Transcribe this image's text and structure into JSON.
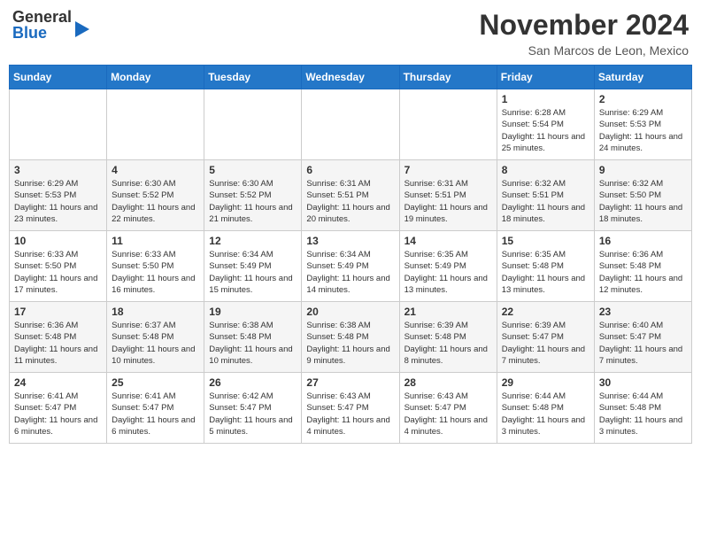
{
  "header": {
    "logo_general": "General",
    "logo_blue": "Blue",
    "month_title": "November 2024",
    "subtitle": "San Marcos de Leon, Mexico"
  },
  "days_of_week": [
    "Sunday",
    "Monday",
    "Tuesday",
    "Wednesday",
    "Thursday",
    "Friday",
    "Saturday"
  ],
  "weeks": [
    {
      "days": [
        {
          "date": "",
          "info": ""
        },
        {
          "date": "",
          "info": ""
        },
        {
          "date": "",
          "info": ""
        },
        {
          "date": "",
          "info": ""
        },
        {
          "date": "",
          "info": ""
        },
        {
          "date": "1",
          "info": "Sunrise: 6:28 AM\nSunset: 5:54 PM\nDaylight: 11 hours\nand 25 minutes."
        },
        {
          "date": "2",
          "info": "Sunrise: 6:29 AM\nSunset: 5:53 PM\nDaylight: 11 hours\nand 24 minutes."
        }
      ]
    },
    {
      "days": [
        {
          "date": "3",
          "info": "Sunrise: 6:29 AM\nSunset: 5:53 PM\nDaylight: 11 hours\nand 23 minutes."
        },
        {
          "date": "4",
          "info": "Sunrise: 6:30 AM\nSunset: 5:52 PM\nDaylight: 11 hours\nand 22 minutes."
        },
        {
          "date": "5",
          "info": "Sunrise: 6:30 AM\nSunset: 5:52 PM\nDaylight: 11 hours\nand 21 minutes."
        },
        {
          "date": "6",
          "info": "Sunrise: 6:31 AM\nSunset: 5:51 PM\nDaylight: 11 hours\nand 20 minutes."
        },
        {
          "date": "7",
          "info": "Sunrise: 6:31 AM\nSunset: 5:51 PM\nDaylight: 11 hours\nand 19 minutes."
        },
        {
          "date": "8",
          "info": "Sunrise: 6:32 AM\nSunset: 5:51 PM\nDaylight: 11 hours\nand 18 minutes."
        },
        {
          "date": "9",
          "info": "Sunrise: 6:32 AM\nSunset: 5:50 PM\nDaylight: 11 hours\nand 18 minutes."
        }
      ]
    },
    {
      "days": [
        {
          "date": "10",
          "info": "Sunrise: 6:33 AM\nSunset: 5:50 PM\nDaylight: 11 hours\nand 17 minutes."
        },
        {
          "date": "11",
          "info": "Sunrise: 6:33 AM\nSunset: 5:50 PM\nDaylight: 11 hours\nand 16 minutes."
        },
        {
          "date": "12",
          "info": "Sunrise: 6:34 AM\nSunset: 5:49 PM\nDaylight: 11 hours\nand 15 minutes."
        },
        {
          "date": "13",
          "info": "Sunrise: 6:34 AM\nSunset: 5:49 PM\nDaylight: 11 hours\nand 14 minutes."
        },
        {
          "date": "14",
          "info": "Sunrise: 6:35 AM\nSunset: 5:49 PM\nDaylight: 11 hours\nand 13 minutes."
        },
        {
          "date": "15",
          "info": "Sunrise: 6:35 AM\nSunset: 5:48 PM\nDaylight: 11 hours\nand 13 minutes."
        },
        {
          "date": "16",
          "info": "Sunrise: 6:36 AM\nSunset: 5:48 PM\nDaylight: 11 hours\nand 12 minutes."
        }
      ]
    },
    {
      "days": [
        {
          "date": "17",
          "info": "Sunrise: 6:36 AM\nSunset: 5:48 PM\nDaylight: 11 hours\nand 11 minutes."
        },
        {
          "date": "18",
          "info": "Sunrise: 6:37 AM\nSunset: 5:48 PM\nDaylight: 11 hours\nand 10 minutes."
        },
        {
          "date": "19",
          "info": "Sunrise: 6:38 AM\nSunset: 5:48 PM\nDaylight: 11 hours\nand 10 minutes."
        },
        {
          "date": "20",
          "info": "Sunrise: 6:38 AM\nSunset: 5:48 PM\nDaylight: 11 hours\nand 9 minutes."
        },
        {
          "date": "21",
          "info": "Sunrise: 6:39 AM\nSunset: 5:48 PM\nDaylight: 11 hours\nand 8 minutes."
        },
        {
          "date": "22",
          "info": "Sunrise: 6:39 AM\nSunset: 5:47 PM\nDaylight: 11 hours\nand 7 minutes."
        },
        {
          "date": "23",
          "info": "Sunrise: 6:40 AM\nSunset: 5:47 PM\nDaylight: 11 hours\nand 7 minutes."
        }
      ]
    },
    {
      "days": [
        {
          "date": "24",
          "info": "Sunrise: 6:41 AM\nSunset: 5:47 PM\nDaylight: 11 hours\nand 6 minutes."
        },
        {
          "date": "25",
          "info": "Sunrise: 6:41 AM\nSunset: 5:47 PM\nDaylight: 11 hours\nand 6 minutes."
        },
        {
          "date": "26",
          "info": "Sunrise: 6:42 AM\nSunset: 5:47 PM\nDaylight: 11 hours\nand 5 minutes."
        },
        {
          "date": "27",
          "info": "Sunrise: 6:43 AM\nSunset: 5:47 PM\nDaylight: 11 hours\nand 4 minutes."
        },
        {
          "date": "28",
          "info": "Sunrise: 6:43 AM\nSunset: 5:47 PM\nDaylight: 11 hours\nand 4 minutes."
        },
        {
          "date": "29",
          "info": "Sunrise: 6:44 AM\nSunset: 5:48 PM\nDaylight: 11 hours\nand 3 minutes."
        },
        {
          "date": "30",
          "info": "Sunrise: 6:44 AM\nSunset: 5:48 PM\nDaylight: 11 hours\nand 3 minutes."
        }
      ]
    }
  ]
}
